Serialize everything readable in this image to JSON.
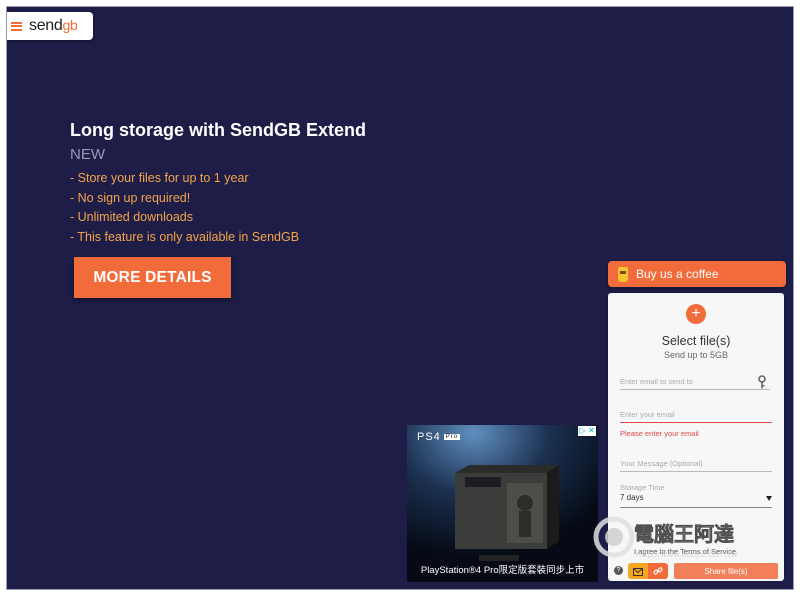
{
  "app": {
    "logo_text": "send",
    "logo_accent": "gb"
  },
  "promo": {
    "title": "Long storage with SendGB Extend",
    "badge": "NEW",
    "features": [
      "- Store your files for up to 1 year",
      "- No sign up required!",
      "- Unlimited downloads",
      "- This feature is only available in SendGB"
    ],
    "cta_label": "MORE DETAILS"
  },
  "coffee": {
    "label": "Buy us a coffee",
    "icon": "coffee-cup-icon"
  },
  "upload": {
    "add_icon": "+",
    "title": "Select file(s)",
    "subtitle": "Send up to 5GB",
    "to_placeholder": "Enter email to send to",
    "from_placeholder": "Enter your email",
    "error": "Please enter your email",
    "message_placeholder": "Your Message (Optional)",
    "storage_label": "Storage Time",
    "storage_value": "7 days",
    "terms_text": "I agree to the Terms of Service",
    "help_icon": "?",
    "share_label": "Share file(s)"
  },
  "ad": {
    "brand": "PS4",
    "pro_badge": "Pro",
    "caption": "PlayStation®4 Pro限定版套裝同步上市",
    "close_icons": [
      "info-icon",
      "close-icon"
    ]
  },
  "watermark": {
    "title": "電腦王阿達",
    "url": "http://www.koopc.com.tw"
  },
  "colors": {
    "background": "#1e1d48",
    "accent": "#f26b3a",
    "feature_text": "#f5a44a",
    "error": "#e04848"
  }
}
